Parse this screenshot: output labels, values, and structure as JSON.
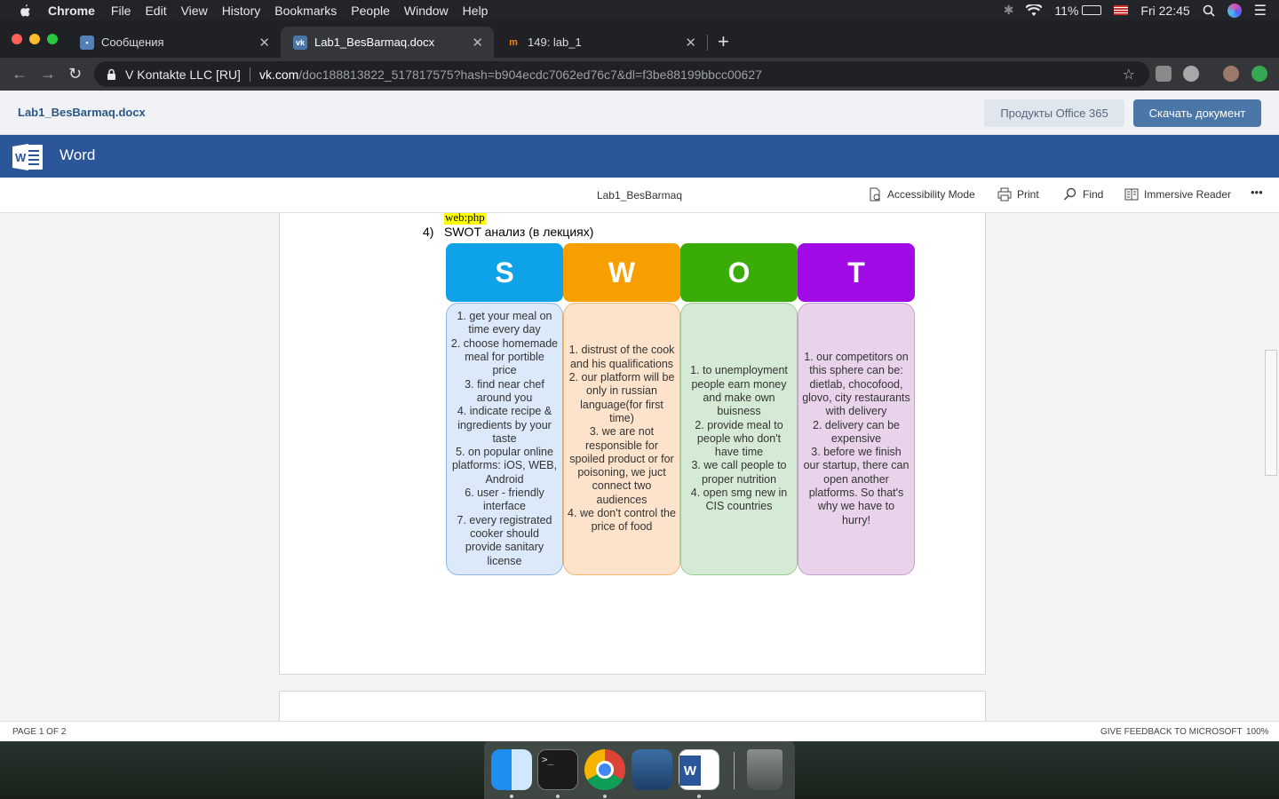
{
  "menubar": {
    "app": "Chrome",
    "items": [
      "File",
      "Edit",
      "View",
      "History",
      "Bookmarks",
      "People",
      "Window",
      "Help"
    ],
    "battery": "11%",
    "clock": "Fri 22:45"
  },
  "tabs": [
    {
      "label": "Сообщения",
      "favicon": "chat-icon"
    },
    {
      "label": "Lab1_BesBarmaq.docx",
      "favicon": "vk-icon"
    },
    {
      "label": "149: lab_1",
      "favicon": "moodle-icon"
    }
  ],
  "address": {
    "site": "V Kontakte LLC [RU]",
    "domain": "vk.com",
    "path": "/doc188813822_517817575?hash=b904ecdc7062ed76c7&dl=f3be88199bbcc00627"
  },
  "vk": {
    "filename": "Lab1_BesBarmaq.docx",
    "office_button": "Продукты Office 365",
    "download_button": "Скачать документ"
  },
  "word": {
    "brand": "Word",
    "doc_title": "Lab1_BesBarmaq",
    "commands": {
      "accessibility": "Accessibility Mode",
      "print": "Print",
      "find": "Find",
      "reader": "Immersive Reader",
      "more": "•••"
    }
  },
  "document": {
    "highlight": "web:php",
    "list_number": "4)",
    "list_text": "SWOT анализ (в лекциях)",
    "swot": [
      {
        "letter": "S",
        "color": "#0ea3e8",
        "bg": "#dce9fb",
        "border": "#8fb4e6",
        "lines": [
          "1. get your meal on",
          "time every day",
          "2. choose homemade",
          "meal for portible",
          "price",
          "3. find near chef",
          "around you",
          "4. indicate recipe &",
          "ingredients by your",
          "taste",
          "5. on popular online",
          "platforms: iOS, WEB,",
          "Android",
          "6. user - friendly",
          "interface",
          "7. every registrated",
          "cooker should",
          "provide sanitary",
          "license"
        ]
      },
      {
        "letter": "W",
        "color": "#f89f00",
        "bg": "#fde3cc",
        "border": "#f0b870",
        "lines": [
          "1. distrust of the cook",
          "and his qualifications",
          "2. our platform will be",
          "only in russian",
          "language(for first",
          "time)",
          "3. we are not",
          "responsible for",
          "spoiled product or for",
          "poisoning, we juct",
          "connect two",
          "audiences",
          "4. we don't control the",
          "price of food"
        ]
      },
      {
        "letter": "O",
        "color": "#3aac07",
        "bg": "#d5ead4",
        "border": "#9ccc98",
        "lines": [
          "1. to unemployment",
          "people earn money",
          "and make own",
          "buisness",
          "2. provide meal to",
          "people who don't",
          "have time",
          "3. we call people to",
          "proper nutrition",
          "4. open smg new in",
          "CIS countries"
        ]
      },
      {
        "letter": "T",
        "color": "#a10ce6",
        "bg": "#e8d3ea",
        "border": "#c6a0cc",
        "lines": [
          "1. our competitors on",
          "this sphere can be:",
          "dietlab, chocofood,",
          "glovo, city restaurants",
          "with delivery",
          "2. delivery can be",
          "expensive",
          "3. before we finish",
          "our startup, there can",
          "open another",
          "platforms. So that's",
          "why we have to",
          "hurry!"
        ]
      }
    ]
  },
  "status": {
    "page": "PAGE 1 OF 2",
    "feedback": "GIVE FEEDBACK TO MICROSOFT",
    "zoom": "100%"
  },
  "colors": {
    "word_blue": "#2b579a",
    "vk_blue": "#4a76a8"
  },
  "dock": [
    "finder-icon",
    "terminal-icon",
    "chrome-icon",
    "mysql-workbench-icon",
    "word-icon",
    "trash-icon"
  ]
}
